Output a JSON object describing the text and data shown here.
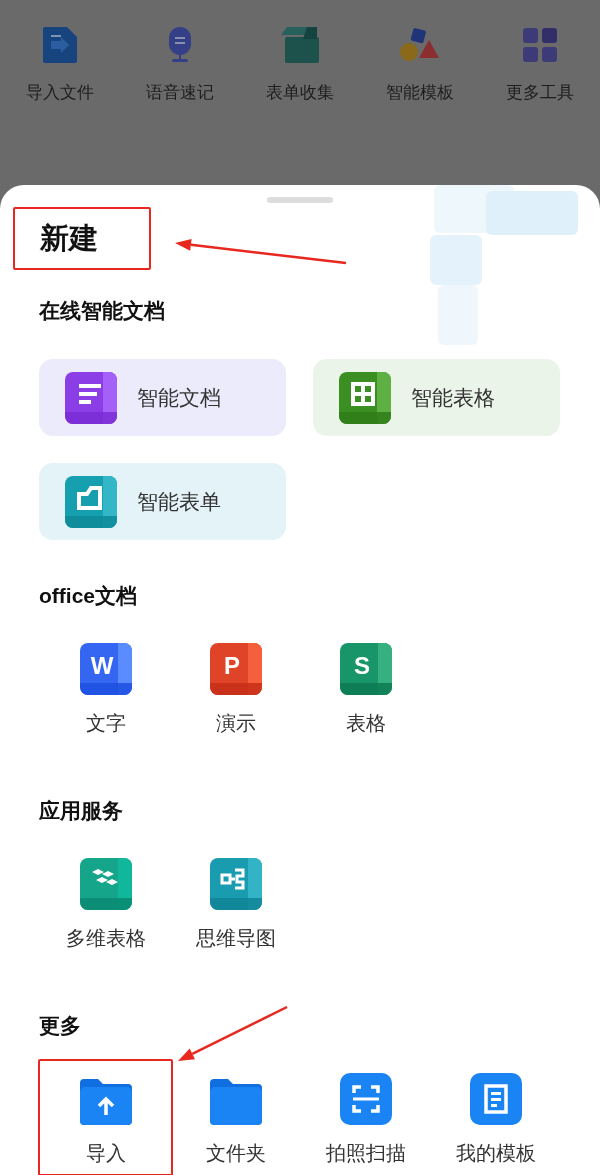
{
  "toolbar": [
    {
      "label": "导入文件",
      "kind": "import"
    },
    {
      "label": "语音速记",
      "kind": "mic"
    },
    {
      "label": "表单收集",
      "kind": "box"
    },
    {
      "label": "智能模板",
      "kind": "shapes"
    },
    {
      "label": "更多工具",
      "kind": "grid"
    }
  ],
  "sheet": {
    "title": "新建",
    "title_highlighted": true,
    "sections": [
      {
        "title": "在线智能文档",
        "kind": "cards",
        "items": [
          {
            "label": "智能文档",
            "kind": "smartdoc",
            "highlighted": false
          },
          {
            "label": "智能表格",
            "kind": "smartsheet",
            "highlighted": false
          },
          {
            "label": "智能表单",
            "kind": "smartform",
            "highlighted": false
          }
        ]
      },
      {
        "title": "office文档",
        "kind": "tiles",
        "items": [
          {
            "label": "文字",
            "kind": "word",
            "glyph": "W",
            "highlighted": false
          },
          {
            "label": "演示",
            "kind": "ppt",
            "glyph": "P",
            "highlighted": false
          },
          {
            "label": "表格",
            "kind": "excel",
            "glyph": "S",
            "highlighted": false
          }
        ]
      },
      {
        "title": "应用服务",
        "kind": "tiles",
        "items": [
          {
            "label": "多维表格",
            "kind": "multi",
            "highlighted": false
          },
          {
            "label": "思维导图",
            "kind": "mind",
            "highlighted": false
          }
        ]
      },
      {
        "title": "更多",
        "kind": "tiles",
        "items": [
          {
            "label": "导入",
            "kind": "upload",
            "highlighted": true
          },
          {
            "label": "文件夹",
            "kind": "folder",
            "highlighted": false
          },
          {
            "label": "拍照扫描",
            "kind": "scan",
            "highlighted": false
          },
          {
            "label": "我的模板",
            "kind": "template",
            "highlighted": false
          }
        ]
      }
    ]
  }
}
